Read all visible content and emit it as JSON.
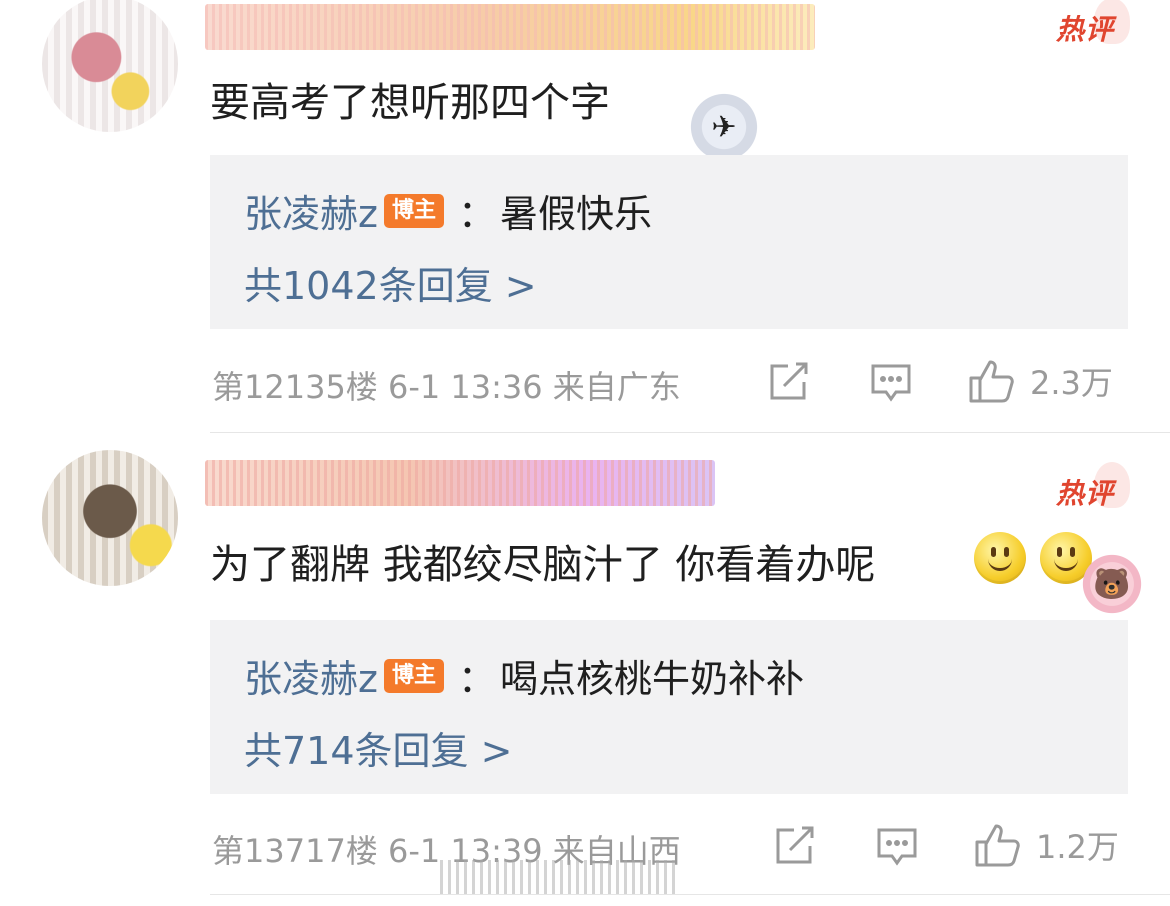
{
  "comments": [
    {
      "body": "要高考了想听那四个字",
      "hot_label": "热评",
      "reply": {
        "author": "张凌赫z",
        "badge": "博主",
        "separator": "：",
        "text": "暑假快乐",
        "count_label": "共1042条回复 >"
      },
      "meta": "第12135楼 6-1 13:36 来自广东",
      "likes": "2.3万"
    },
    {
      "body": "为了翻牌 我都绞尽脑汁了 你看着办呢",
      "hot_label": "热评",
      "reply": {
        "author": "张凌赫z",
        "badge": "博主",
        "separator": "：",
        "text": "喝点核桃牛奶补补",
        "count_label": "共714条回复 >"
      },
      "meta": "第13717楼 6-1 13:39 来自山西",
      "likes": "1.2万"
    }
  ],
  "icons": {
    "share": "share-icon",
    "comment": "comment-icon",
    "like": "thumbs-up-icon",
    "emoji": "smile-emoji-icon",
    "sticker_1": "airplane-sticker-icon",
    "sticker_2": "pink-bear-sticker-icon"
  },
  "colors": {
    "link": "#4e6f94",
    "badge": "#f47a2b",
    "hot": "#e0452f",
    "reply_bg": "#f2f2f3",
    "meta": "#9a9a9a"
  }
}
